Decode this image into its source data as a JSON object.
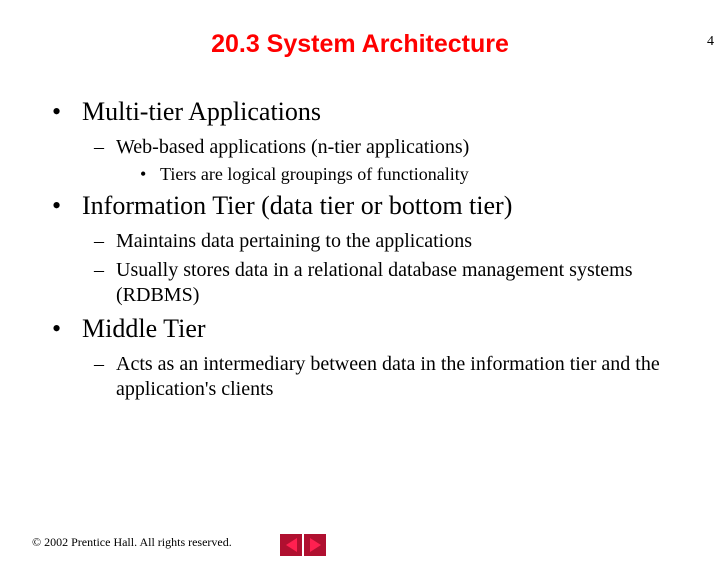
{
  "slide_number": "4",
  "title": "20.3 System Architecture",
  "bullets": {
    "b1": "Multi-tier Applications",
    "b1_1": "Web-based applications (n-tier applications)",
    "b1_1_1": "Tiers are logical groupings of functionality",
    "b2": "Information Tier (data tier or bottom tier)",
    "b2_1": "Maintains data pertaining to the applications",
    "b2_2": "Usually stores data in a relational database management systems (RDBMS)",
    "b3": "Middle Tier",
    "b3_1": "Acts as an intermediary between data in the information tier and the application's clients"
  },
  "footer": "2002 Prentice Hall. All rights reserved.",
  "copyright_symbol": "©"
}
